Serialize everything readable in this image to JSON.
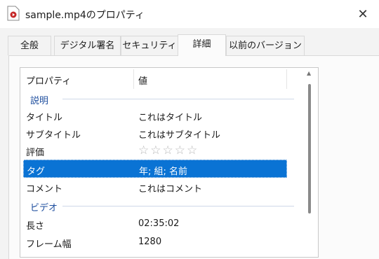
{
  "window": {
    "title": "sample.mp4のプロパティ",
    "icon": "video-file-icon",
    "close_symbol": "✕"
  },
  "tabs": [
    {
      "label": "全般",
      "active": false
    },
    {
      "label": "デジタル署名",
      "active": false
    },
    {
      "label": "セキュリティ",
      "active": false
    },
    {
      "label": "詳細",
      "active": true
    },
    {
      "label": "以前のバージョン",
      "active": false
    }
  ],
  "list": {
    "header": {
      "property": "プロパティ",
      "value": "値"
    },
    "rows": [
      {
        "type": "group",
        "key": "説明"
      },
      {
        "type": "item",
        "key": "タイトル",
        "value": "これはタイトル"
      },
      {
        "type": "item",
        "key": "サブタイトル",
        "value": "これはサブタイトル"
      },
      {
        "type": "rating",
        "key": "評価",
        "stars": "☆☆☆☆☆",
        "rating": 0,
        "max_rating": 5
      },
      {
        "type": "item",
        "key": "タグ",
        "value": "年; 組; 名前",
        "selected": true
      },
      {
        "type": "item",
        "key": "コメント",
        "value": "これはコメント"
      },
      {
        "type": "group",
        "key": "ビデオ"
      },
      {
        "type": "item",
        "key": "長さ",
        "value": "02:35:02"
      },
      {
        "type": "item",
        "key": "フレーム幅",
        "value": "1280"
      }
    ]
  },
  "colors": {
    "selection": "#0a73d4",
    "group_header": "#1e4e9e"
  }
}
